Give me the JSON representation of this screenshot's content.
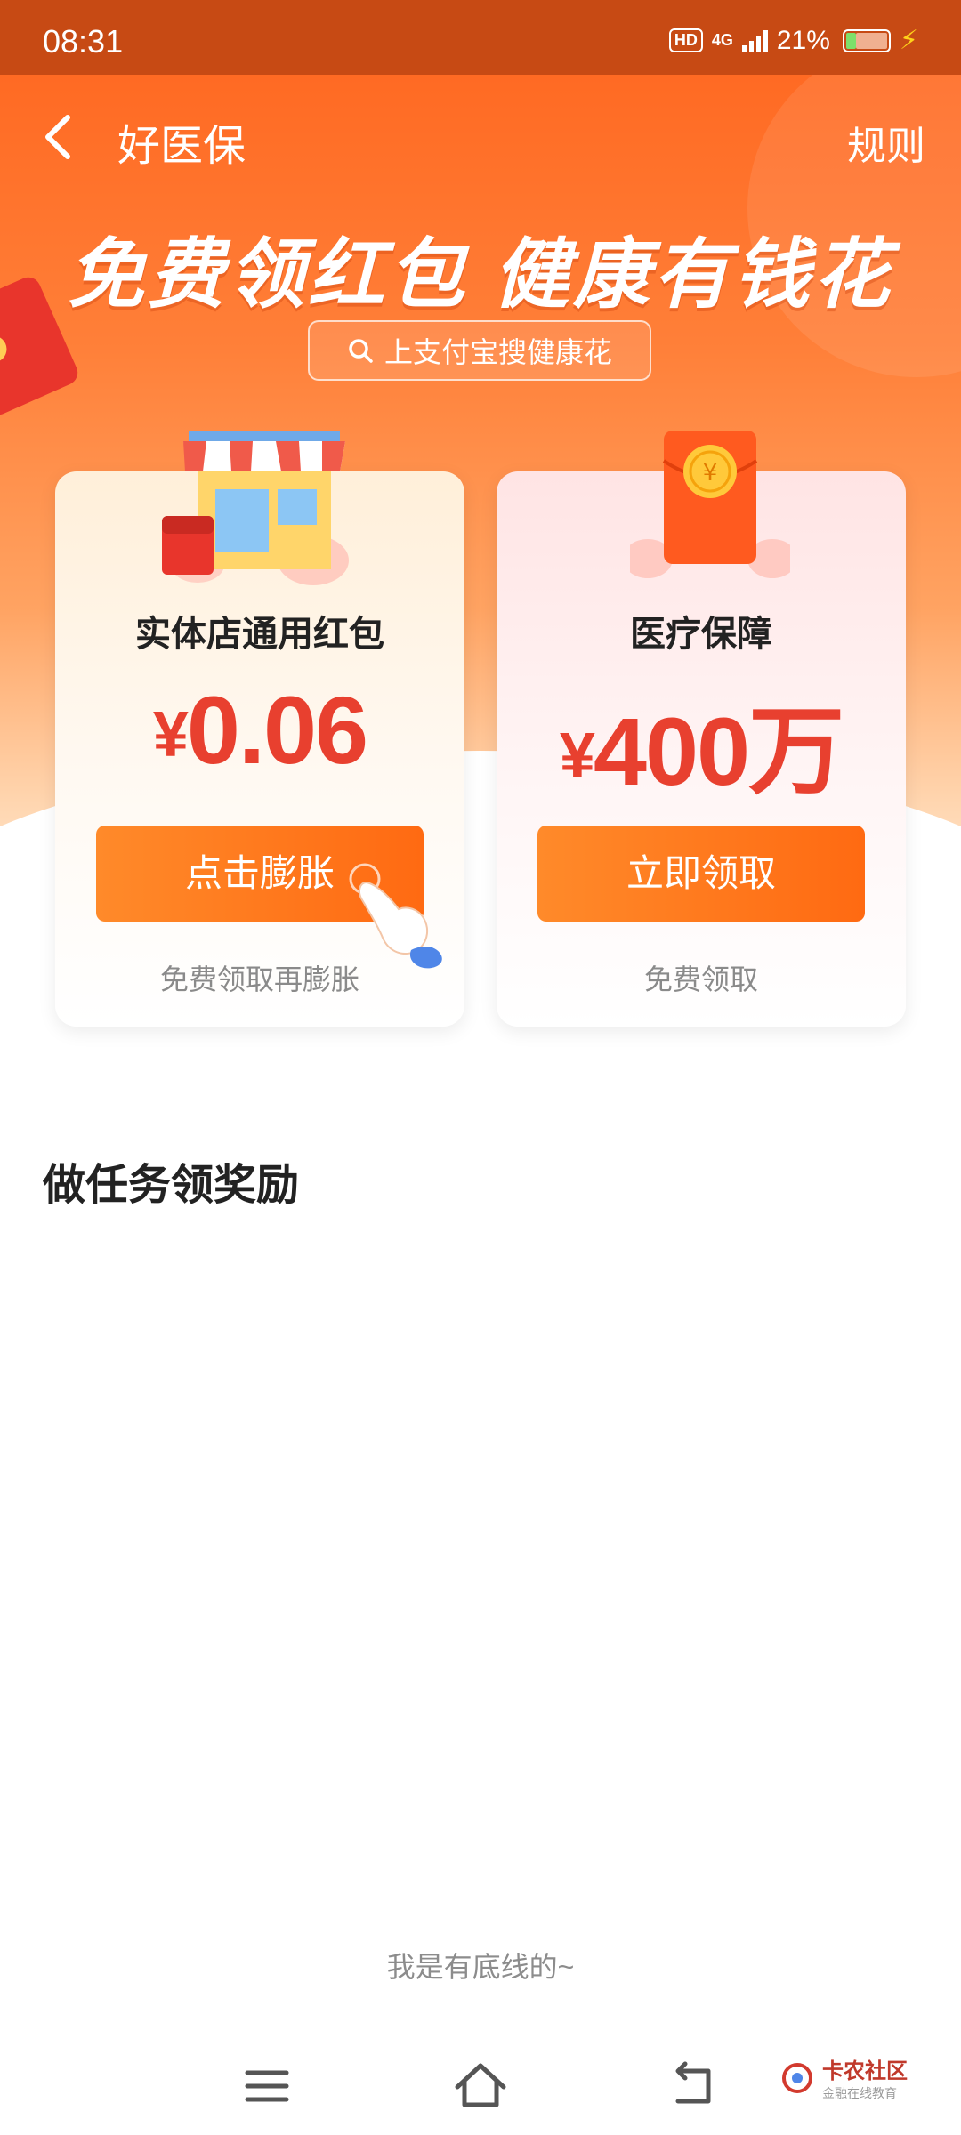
{
  "status_bar": {
    "time": "08:31",
    "hd_badge": "HD",
    "network": "4G",
    "battery": "21%",
    "battery_level": 0.21
  },
  "nav": {
    "title": "好医保",
    "rules": "规则",
    "back_icon": "chevron-left-icon"
  },
  "hero": {
    "slogan": "免费领红包 健康有钱花",
    "search_hint": "上支付宝搜健康花",
    "search_icon": "search-icon"
  },
  "cards": [
    {
      "title": "实体店通用红包",
      "currency": "¥",
      "amount": "0.06",
      "button": "点击膨胀",
      "subtitle": "免费领取再膨胀",
      "illustration": "storefront-icon"
    },
    {
      "title": "医疗保障",
      "currency": "¥",
      "amount": "400万",
      "button": "立即领取",
      "subtitle": "免费领取",
      "illustration": "red-envelope-icon"
    }
  ],
  "tasks": {
    "title": "做任务领奖励"
  },
  "footer": {
    "note": "我是有底线的~"
  },
  "system_nav": {
    "menu_icon": "menu-icon",
    "home_icon": "home-icon",
    "back_icon": "back-icon"
  },
  "watermark": {
    "name": "卡农社区",
    "tagline": "金融在线教育"
  },
  "colors": {
    "brand_orange": "#ff6a12",
    "price_red": "#e8402f",
    "status_bar": "#c74a14"
  }
}
